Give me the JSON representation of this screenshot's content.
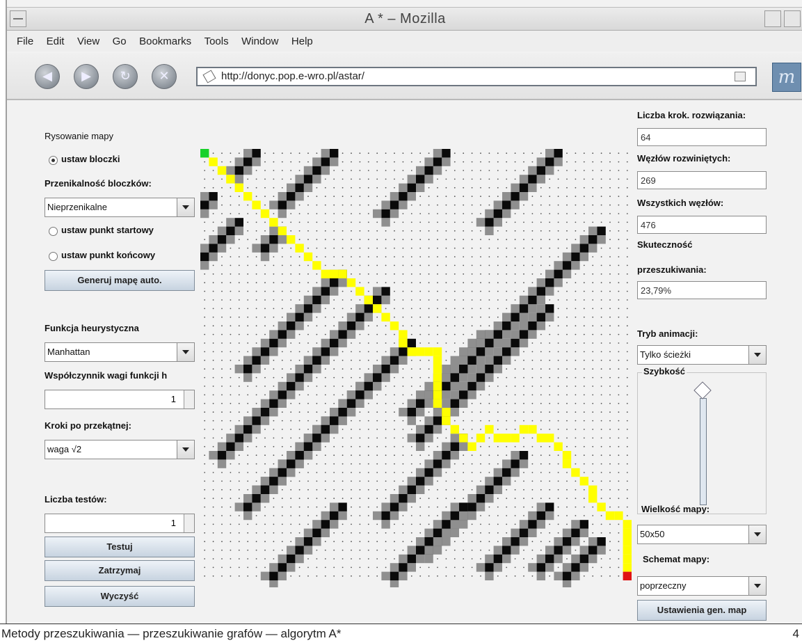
{
  "window": {
    "title": "A * – Mozilla"
  },
  "menu": [
    "File",
    "Edit",
    "View",
    "Go",
    "Bookmarks",
    "Tools",
    "Window",
    "Help"
  ],
  "nav": {
    "url": "http://donyc.pop.e-wro.pl/astar/"
  },
  "left": {
    "map_drawing_label": "Rysowanie mapy",
    "radio_blocks": "ustaw bloczki",
    "permeability_label": "Przenikalność bloczków:",
    "permeability_value": "Nieprzenikalne",
    "radio_start": "ustaw punkt startowy",
    "radio_end": "ustaw punkt końcowy",
    "generate_button": "Generuj mapę auto.",
    "heuristic_label": "Funkcja heurystyczna",
    "heuristic_value": "Manhattan",
    "weight_label": "Współczynnik wagi funkcji h",
    "weight_value": "1",
    "diagonal_label": "Kroki po przekątnej:",
    "diagonal_value": "waga √2",
    "tests_label": "Liczba testów:",
    "tests_value": "1",
    "test_button": "Testuj",
    "stop_button": "Zatrzymaj",
    "clear_button": "Wyczyść"
  },
  "right": {
    "steps_label": "Liczba krok. rozwiązania:",
    "steps_value": "64",
    "expanded_label": "Węzłów rozwiniętych:",
    "expanded_value": "269",
    "all_label": "Wszystkich węzłów:",
    "all_value": "476",
    "efficiency_label1": "Skuteczność",
    "efficiency_label2": "przeszukiwania:",
    "efficiency_value": "23,79%",
    "animation_label": "Tryb animacji:",
    "animation_value": "Tylko ścieżki",
    "speed_label": "Szybkość",
    "speed_level": 0.92,
    "mapsize_label": "Wielkość mapy:",
    "mapsize_value": "50x50",
    "scheme_label": "Schemat mapy:",
    "scheme_value": "poprzeczny",
    "settings_button": "Ustawienia gen. map"
  },
  "map": {
    "colors": {
      "wall": "#0a0a0a",
      "halo": "#8f8f8f",
      "path": "#ffff00",
      "start": "#17d12a",
      "end": "#e01414",
      "dot": "#555555"
    }
  },
  "footer": {
    "text": "Metody przeszukiwania — przeszukiwanie grafów — algorytm A*",
    "page": "4"
  }
}
